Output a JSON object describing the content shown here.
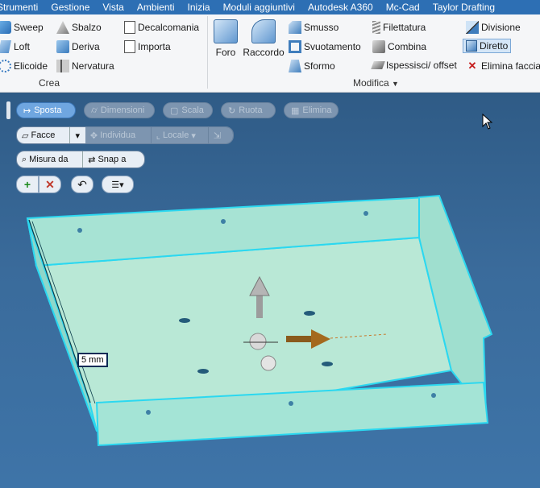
{
  "menu": [
    "Strumenti",
    "Gestione",
    "Vista",
    "Ambienti",
    "Inizia",
    "Moduli aggiuntivi",
    "Autodesk A360",
    "Mc-Cad",
    "Taylor Drafting"
  ],
  "ribbon": {
    "crea": {
      "title": "Crea",
      "col1": [
        "Sweep",
        "Loft",
        "Elicoide"
      ],
      "col2": [
        "Sbalzo",
        "Deriva",
        "Nervatura"
      ],
      "col3": [
        "Decalcomania",
        "Importa"
      ]
    },
    "modifica": {
      "title": "Modifica",
      "big": [
        "Foro",
        "Raccordo"
      ],
      "col1": [
        "Smusso",
        "Svuotamento",
        "Sformo"
      ],
      "col2": [
        "Filettatura",
        "Combina",
        "Ispessisci/ offset"
      ],
      "col3": [
        "Divisione",
        "Diretto",
        "Elimina faccia"
      ]
    }
  },
  "viewport": {
    "toolbar": {
      "sposta": "Sposta",
      "dimensioni": "Dimensioni",
      "scala": "Scala",
      "ruota": "Ruota",
      "elimina": "Elimina"
    },
    "row2": {
      "facce": "Facce",
      "individua": "Individua",
      "locale": "Locale"
    },
    "row3": {
      "misura": "Misura da",
      "snap": "Snap a"
    },
    "dimension_value": "5 mm"
  }
}
